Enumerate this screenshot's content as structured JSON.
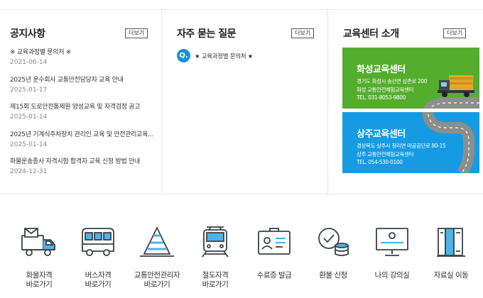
{
  "notice": {
    "title": "공지사항",
    "more_label": "더보기",
    "items": [
      {
        "title": "※ 교육과정별 문의처 ※",
        "date": "2021-06-14"
      },
      {
        "title": "2025년 운수회사 교통안전담당자 교육 안내",
        "date": "2025-01-17"
      },
      {
        "title": "제15회 도로안전통제원 양성교육 및 자격검정 공고",
        "date": "2025-01-14"
      },
      {
        "title": "2025년 기계식주차장치 관리인 교육 및 안전관리교육...",
        "date": "2025-01-14"
      },
      {
        "title": "화물운송종사 자격시험 합격자 교육 신청 방법 안내",
        "date": "2024-12-31"
      }
    ]
  },
  "faq": {
    "title": "자주 묻는 질문",
    "more_label": "더보기",
    "badge": "Q.",
    "items": [
      {
        "title": "★ 교육과정별 문의처 ★"
      }
    ]
  },
  "center": {
    "title": "교육센터 소개",
    "more_label": "더보기",
    "cards": [
      {
        "name": "화성교육센터",
        "address": "경기도 화성시 송산면 삼존로 200",
        "facility": "화성 교통안전체험교육센터",
        "tel": "TEL. 031-8053-9800",
        "color": "#55ad2e"
      },
      {
        "name": "상주교육센터",
        "address": "경상북도 상주시 청리면 마공공단로 80-15",
        "facility": "상주 교통안전체험교육센터",
        "tel": "TEL. 054-530-0100",
        "color": "#169be3"
      }
    ]
  },
  "quick_links": [
    {
      "icon": "cargo-truck-icon",
      "label_line1": "화물자격",
      "label_line2": "바로가기"
    },
    {
      "icon": "bus-icon",
      "label_line1": "버스자격",
      "label_line2": "바로가기"
    },
    {
      "icon": "traffic-cone-icon",
      "label_line1": "교통안전관리자",
      "label_line2": "바로가기"
    },
    {
      "icon": "train-icon",
      "label_line1": "철도자격",
      "label_line2": "바로가기"
    },
    {
      "icon": "id-card-icon",
      "label_line1": "수료증 발급",
      "label_line2": ""
    },
    {
      "icon": "refund-coins-icon",
      "label_line1": "환불 신청",
      "label_line2": ""
    },
    {
      "icon": "monitor-icon",
      "label_line1": "나의 강의실",
      "label_line2": ""
    },
    {
      "icon": "library-books-icon",
      "label_line1": "자료실 이동",
      "label_line2": ""
    }
  ],
  "colors": {
    "accent_blue": "#1a8fd8",
    "green_card": "#55ad2e",
    "blue_card": "#169be3",
    "divider": "#e6e6e6"
  }
}
